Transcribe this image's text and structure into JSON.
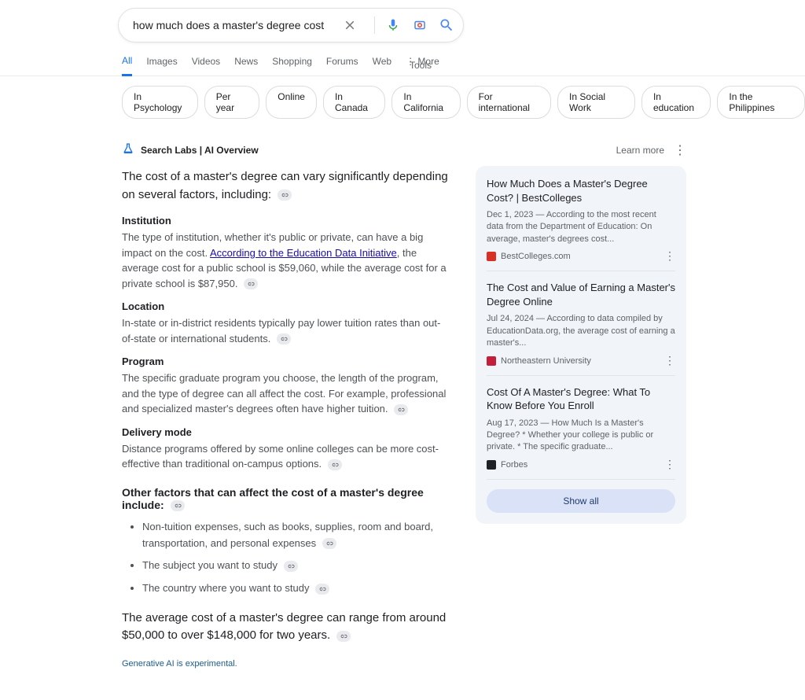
{
  "search": {
    "query": "how much does a master's degree cost"
  },
  "tabs": [
    "All",
    "Images",
    "Videos",
    "News",
    "Shopping",
    "Forums",
    "Web"
  ],
  "more_label": "More",
  "tools_label": "Tools",
  "chips": [
    "In Psychology",
    "Per year",
    "Online",
    "In Canada",
    "In California",
    "For international",
    "In Social Work",
    "In education",
    "In the Philippines"
  ],
  "labs": {
    "label": "Search Labs | AI Overview",
    "learn_more": "Learn more"
  },
  "overview": {
    "intro": "The cost of a master's degree can vary significantly depending on several factors, including:",
    "sections": [
      {
        "heading": "Institution",
        "body_pre": "The type of institution, whether it's public or private, can have a big impact on the cost. ",
        "link_text": "According to the Education Data Initiative",
        "body_post": ", the average cost for a public school is $59,060, while the average cost for a private school is $87,950."
      },
      {
        "heading": "Location",
        "body": "In-state or in-district residents typically pay lower tuition rates than out-of-state or international students."
      },
      {
        "heading": "Program",
        "body": "The specific graduate program you choose, the length of the program, and the type of degree can all affect the cost. For example, professional and specialized master's degrees often have higher tuition."
      },
      {
        "heading": "Delivery mode",
        "body": "Distance programs offered by some online colleges can be more cost-effective than traditional on-campus options."
      }
    ],
    "other_heading": "Other factors that can affect the cost of a master's degree include:",
    "other_items": [
      "Non-tuition expenses, such as books, supplies, room and board, transportation, and personal expenses",
      "The subject you want to study",
      "The country where you want to study"
    ],
    "summary": "The average cost of a master's degree can range from around $50,000 to over $148,000 for two years.",
    "disclaimer": "Generative AI is experimental."
  },
  "cards": [
    {
      "title": "How Much Does a Master's Degree Cost? | BestColleges",
      "snippet": "Dec 1, 2023 — According to the most recent data from the Department of Education: On average, master's degrees cost...",
      "source": "BestColleges.com",
      "favicon_color": "#d93025"
    },
    {
      "title": "The Cost and Value of Earning a Master's Degree Online",
      "snippet": "Jul 24, 2024 — According to data compiled by EducationData.org, the average cost of earning a master's...",
      "source": "Northeastern University",
      "favicon_color": "#c41e3a"
    },
    {
      "title": "Cost Of A Master's Degree: What To Know Before You Enroll",
      "snippet": "Aug 17, 2023 — How Much Is a Master's Degree? * Whether your college is public or private. * The specific graduate...",
      "source": "Forbes",
      "favicon_color": "#202124"
    }
  ],
  "show_all": "Show all"
}
